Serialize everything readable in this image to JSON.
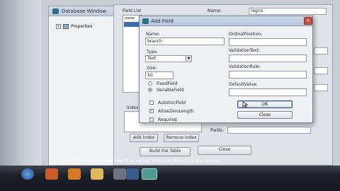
{
  "database_window": {
    "title": "Database Window",
    "tree_item": "Properties"
  },
  "main_dialog": {
    "field_list_label": "Field List",
    "field_list_items": [
      "name"
    ],
    "name_label": "Name:",
    "name_value": "regno",
    "add_index_button": "Add Index",
    "remove_index_button": "Remove Index",
    "index_label": "Index",
    "fields_label": "Fields:",
    "build_table_button": "Build the Table",
    "close_button": "Close"
  },
  "add_field_dialog": {
    "title": "Add Field",
    "name_label": "Name:",
    "name_value": "branch",
    "type_label": "Type:",
    "type_value": "Text",
    "size_label": "Size:",
    "size_value": "50",
    "fixed_field_label": "FixedField",
    "variable_field_label": "VariableField",
    "auto_incr_label": "AutoIncrField",
    "allow_zero_length_label": "AllowZeroLength",
    "required_label": "Required",
    "ordinal_position_label": "OrdinalPosition:",
    "validation_text_label": "ValidationText:",
    "validation_rule_label": "ValidationRule:",
    "default_value_label": "DefaultValue:",
    "ok_button": "OK",
    "close_button": "Close"
  },
  "status_bar": {
    "text": "Enter New Field Parameters, Press OK to add field to Field List. Press Close when finished"
  },
  "colors": {
    "titlebar": "#c2cbd8",
    "selection": "#3d6fb0",
    "taskbar": "#1d2028"
  },
  "taskbar_icons": [
    "start-orb-icon",
    "media-player-icon",
    "firefox-icon",
    "folder-icon",
    "app-icon",
    "vb-icon",
    "dataform-icon"
  ]
}
